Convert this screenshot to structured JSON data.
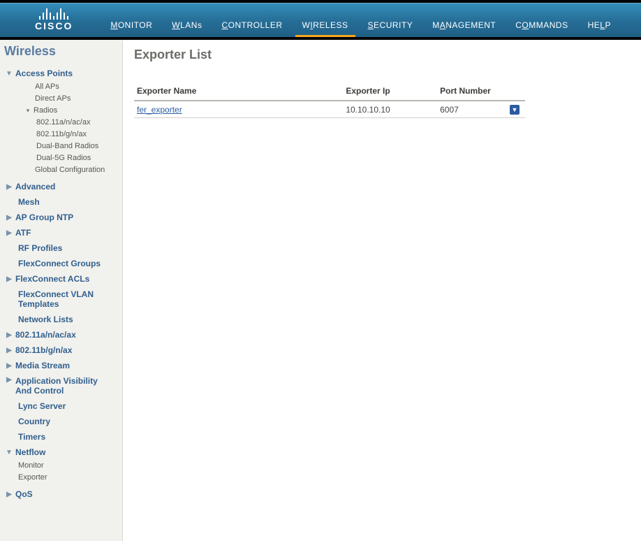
{
  "brand": "CISCO",
  "nav": {
    "monitor": {
      "u": "M",
      "rest": "ONITOR"
    },
    "wlans": {
      "u": "W",
      "rest": "LANs"
    },
    "controller": {
      "u": "C",
      "rest": "ONTROLLER"
    },
    "wireless": {
      "u": "W",
      "mid": "I",
      "pre": "",
      "rest": "RELESS"
    },
    "security": {
      "u": "S",
      "rest": "ECURITY"
    },
    "management": {
      "u": "M",
      "mid": "A",
      "rest": "NAGEMENT"
    },
    "commands": {
      "u": "C",
      "mid": "O",
      "rest": "MMANDS"
    },
    "help": {
      "u": "HE",
      "mid": "L",
      "rest": "P"
    }
  },
  "sidebar": {
    "title": "Wireless",
    "accessPoints": {
      "label": "Access Points",
      "allAps": "All APs",
      "directAps": "Direct APs",
      "radios": "Radios",
      "r1": "802.11a/n/ac/ax",
      "r2": "802.11b/g/n/ax",
      "r3": "Dual-Band Radios",
      "r4": "Dual-5G Radios",
      "globalConfig": "Global Configuration"
    },
    "advanced": "Advanced",
    "mesh": "Mesh",
    "apGroupNtp": "AP Group NTP",
    "atf": "ATF",
    "rfProfiles": "RF Profiles",
    "flexConnectGroups": "FlexConnect Groups",
    "flexConnectAcls": "FlexConnect ACLs",
    "flexConnectVlan": "FlexConnect VLAN Templates",
    "networkLists": "Network Lists",
    "b80211a": "802.11a/n/ac/ax",
    "b80211b": "802.11b/g/n/ax",
    "mediaStream": "Media Stream",
    "avc": "Application Visibility And Control",
    "lync": "Lync Server",
    "country": "Country",
    "timers": "Timers",
    "netflow": {
      "label": "Netflow",
      "monitor": "Monitor",
      "exporter": "Exporter"
    },
    "qos": "QoS"
  },
  "content": {
    "title": "Exporter List",
    "columns": {
      "name": "Exporter Name",
      "ip": "Exporter Ip",
      "port": "Port Number"
    },
    "rows": [
      {
        "name": "fer_exporter",
        "ip": "10.10.10.10",
        "port": "6007"
      }
    ]
  }
}
